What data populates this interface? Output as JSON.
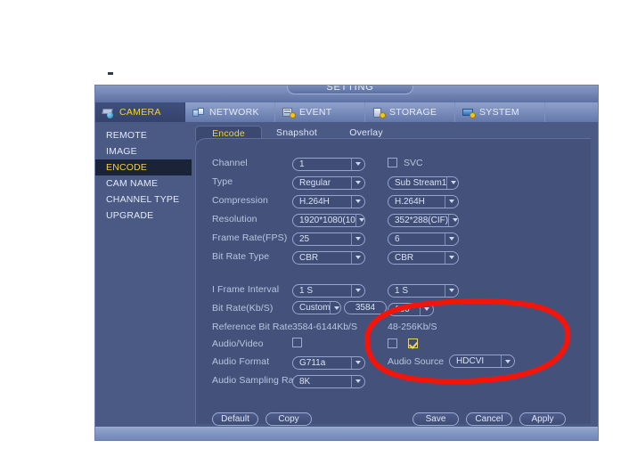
{
  "window": {
    "title": "SETTING"
  },
  "tabs": [
    {
      "label": "CAMERA",
      "icon": "camera-icon",
      "active": true
    },
    {
      "label": "NETWORK",
      "icon": "network-icon",
      "active": false
    },
    {
      "label": "EVENT",
      "icon": "event-icon",
      "active": false
    },
    {
      "label": "STORAGE",
      "icon": "storage-icon",
      "active": false
    },
    {
      "label": "SYSTEM",
      "icon": "system-icon",
      "active": false
    }
  ],
  "sidebar": {
    "items": [
      {
        "label": "REMOTE",
        "active": false
      },
      {
        "label": "IMAGE",
        "active": false
      },
      {
        "label": "ENCODE",
        "active": true
      },
      {
        "label": "CAM NAME",
        "active": false
      },
      {
        "label": "CHANNEL TYPE",
        "active": false
      },
      {
        "label": "UPGRADE",
        "active": false
      }
    ]
  },
  "subtabs": [
    {
      "label": "Encode",
      "active": true
    },
    {
      "label": "Snapshot",
      "active": false
    },
    {
      "label": "Overlay",
      "active": false
    }
  ],
  "form": {
    "svc": {
      "label": "SVC",
      "checked": false
    },
    "rows": [
      {
        "label": "Channel",
        "main": "1",
        "sub": null
      },
      {
        "label": "Type",
        "main": "Regular",
        "sub": "Sub Stream1"
      },
      {
        "label": "Compression",
        "main": "H.264H",
        "sub": "H.264H"
      },
      {
        "label": "Resolution",
        "main": "1920*1080(10",
        "sub": "352*288(CIF)"
      },
      {
        "label": "Frame Rate(FPS)",
        "main": "25",
        "sub": "6"
      },
      {
        "label": "Bit Rate Type",
        "main": "CBR",
        "sub": "CBR"
      }
    ],
    "i_frame": {
      "label": "I Frame Interval",
      "main": "1 S",
      "sub": "1 S"
    },
    "bit_rate": {
      "label": "Bit Rate(Kb/S)",
      "main_mode": "Custom",
      "main_value": "3584",
      "sub": "160"
    },
    "reference": {
      "label": "Reference Bit Rate",
      "main": "3584-6144Kb/S",
      "sub": "48-256Kb/S"
    },
    "audio_video": {
      "label": "Audio/Video",
      "main_checked": false,
      "sub_checked": false,
      "sub_extra_checked": true
    },
    "audio_format": {
      "label": "Audio Format",
      "value": "G711a"
    },
    "audio_sampling": {
      "label": "Audio Sampling Rate",
      "value": "8K"
    },
    "audio_source": {
      "label": "Audio Source",
      "value": "HDCVI"
    }
  },
  "buttons": {
    "default": "Default",
    "copy": "Copy",
    "save": "Save",
    "cancel": "Cancel",
    "apply": "Apply"
  },
  "annotation": {
    "color": "#f5140a",
    "shape": "hand-drawn-ellipse"
  }
}
